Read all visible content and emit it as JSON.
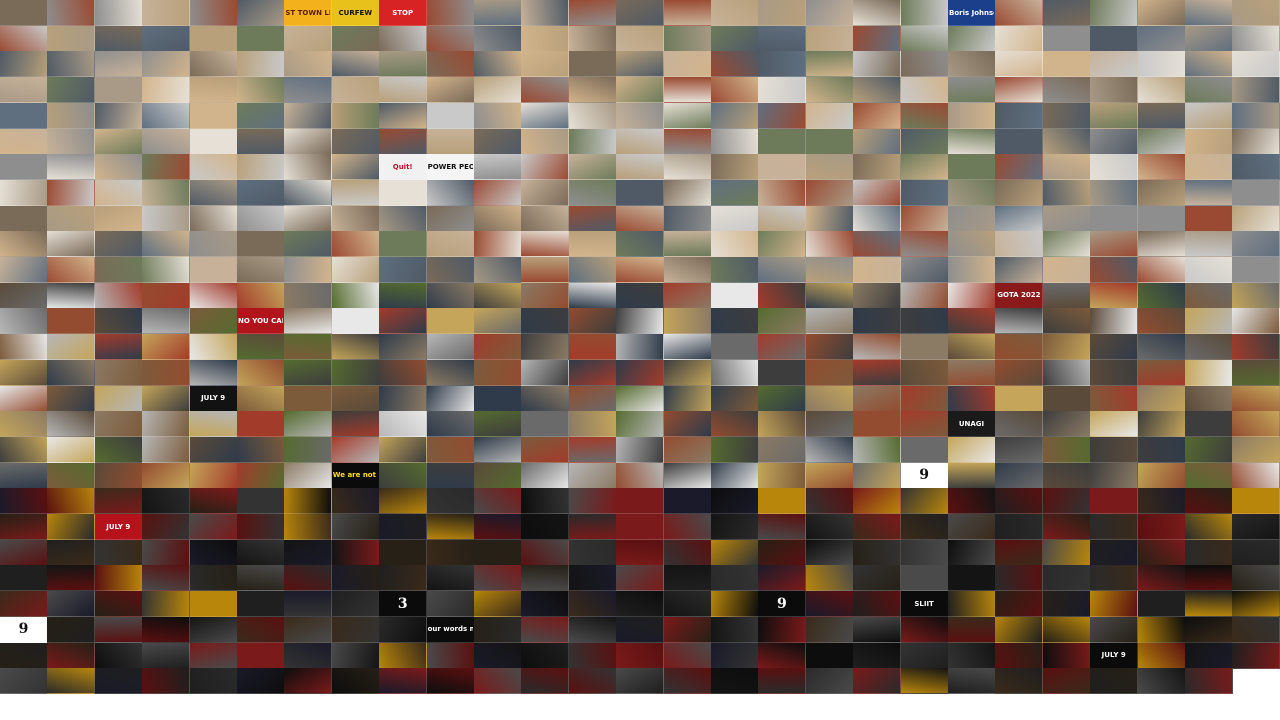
{
  "mosaic": {
    "columns": 27,
    "rows": 27,
    "overlay_texts": [
      {
        "row": 0,
        "col": 6,
        "text": "ST TOWN LIVE",
        "color": "#5a1a00",
        "bg": "#f3b21b"
      },
      {
        "row": 0,
        "col": 7,
        "text": "CURFEW",
        "color": "#111111",
        "bg": "#e8c21a"
      },
      {
        "row": 0,
        "col": 8,
        "text": "STOP",
        "color": "#ffffff",
        "bg": "#d72323"
      },
      {
        "row": 0,
        "col": 20,
        "text": "Boris Johnson",
        "color": "#ffffff",
        "bg": "#1b3f8a"
      },
      {
        "row": 6,
        "col": 8,
        "text": "Quit!",
        "color": "#c8102e",
        "bg": "#f1f1f1"
      },
      {
        "row": 6,
        "col": 9,
        "text": "POWER PEOPLE",
        "color": "#111111",
        "bg": "#f5f5f5"
      },
      {
        "row": 11,
        "col": 21,
        "text": "GOTA 2022",
        "color": "#ffffff",
        "bg": "#8b1a1a"
      },
      {
        "row": 12,
        "col": 5,
        "text": "NO YOU CAN'T",
        "color": "#ffffff",
        "bg": "#b2141c"
      },
      {
        "row": 15,
        "col": 4,
        "text": "JULY 9",
        "color": "#ffffff",
        "bg": "#121212"
      },
      {
        "row": 16,
        "col": 20,
        "text": "UNAGI",
        "color": "#ffffff",
        "bg": "#1a1a1a"
      },
      {
        "row": 18,
        "col": 7,
        "text": "We are not Poor / We were Robbed",
        "color": "#ffe000",
        "bg": "#0b0b0b"
      },
      {
        "row": 18,
        "col": 19,
        "text": "9",
        "color": "#111111",
        "bg": "#ffffff",
        "big": true
      },
      {
        "row": 20,
        "col": 2,
        "text": "JULY 9",
        "color": "#ffffff",
        "bg": "#b5121b"
      },
      {
        "row": 23,
        "col": 8,
        "text": "3",
        "color": "#ffffff",
        "bg": "#0b0b0b",
        "big": true
      },
      {
        "row": 23,
        "col": 16,
        "text": "9",
        "color": "#ffffff",
        "bg": "#0b0b0b",
        "big": true
      },
      {
        "row": 23,
        "col": 19,
        "text": "SLIIT",
        "color": "#ffffff",
        "bg": "#0b0b0b"
      },
      {
        "row": 24,
        "col": 0,
        "text": "9",
        "color": "#111111",
        "bg": "#ffffff",
        "big": true
      },
      {
        "row": 24,
        "col": 9,
        "text": "our words matter.",
        "color": "#ffffff",
        "bg": "#0b0b0b"
      },
      {
        "row": 25,
        "col": 23,
        "text": "JULY 9",
        "color": "#ffffff",
        "bg": "#0b0b0b"
      }
    ],
    "background": "#ffffff"
  }
}
